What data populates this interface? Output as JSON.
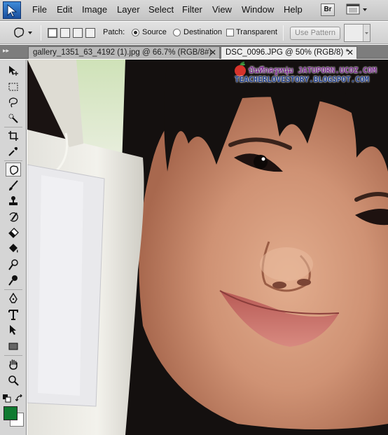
{
  "menu": {
    "items": [
      "File",
      "Edit",
      "Image",
      "Layer",
      "Select",
      "Filter",
      "View",
      "Window",
      "Help"
    ],
    "bridge_label": "Br"
  },
  "options": {
    "patch_label": "Patch:",
    "source_label": "Source",
    "destination_label": "Destination",
    "transparent_label": "Transparent",
    "use_pattern_label": "Use Pattern",
    "patch_mode": "Source",
    "transparent_checked": false
  },
  "tabs": [
    {
      "label": "gallery_1351_63_4192 (1).jpg @ 66.7% (RGB/8#)",
      "active": false
    },
    {
      "label": "DSC_0096.JPG @ 50% (RGB/8) *",
      "active": true
    }
  ],
  "tools": [
    {
      "name": "move-tool-icon"
    },
    {
      "name": "marquee-tool-icon"
    },
    {
      "name": "lasso-tool-icon"
    },
    {
      "name": "quick-selection-tool-icon"
    },
    {
      "name": "crop-tool-icon"
    },
    {
      "name": "eyedropper-tool-icon"
    },
    {
      "name": "patch-tool-icon",
      "active": true
    },
    {
      "name": "brush-tool-icon"
    },
    {
      "name": "clone-stamp-tool-icon"
    },
    {
      "name": "history-brush-tool-icon"
    },
    {
      "name": "eraser-tool-icon"
    },
    {
      "name": "paint-bucket-tool-icon"
    },
    {
      "name": "dodge-tool-icon"
    },
    {
      "name": "sponge-tool-icon"
    },
    {
      "name": "pen-tool-icon"
    },
    {
      "name": "type-tool-icon"
    },
    {
      "name": "path-selection-tool-icon"
    },
    {
      "name": "rectangle-tool-icon"
    },
    {
      "name": "hand-tool-icon"
    },
    {
      "name": "zoom-tool-icon"
    }
  ],
  "colors": {
    "foreground": "#0f7a30",
    "background": "#ffffff",
    "accent": "#1a4f9e"
  },
  "watermark": {
    "line1": "บันทึกครูหนุ่ม JATUPORN.UCOZ.COM",
    "line2": "TEACHERLOVESTORY.BLOGSPOT.COM"
  }
}
